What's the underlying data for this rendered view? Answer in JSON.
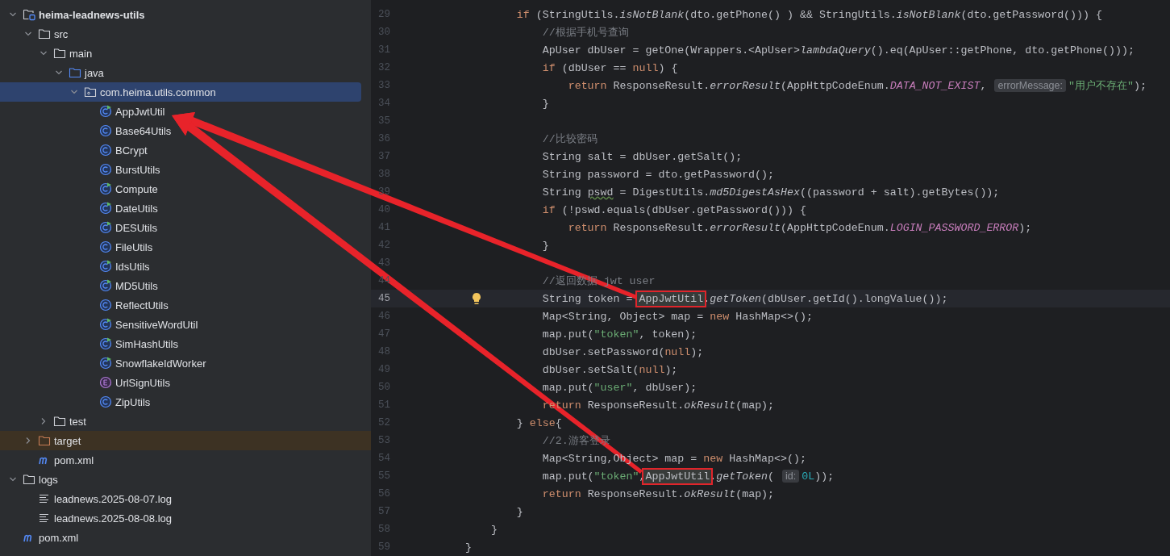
{
  "project_tree": {
    "items": [
      {
        "label": "heima-leadnews-utils",
        "kind": "module",
        "bold": true,
        "expanded": true,
        "selected": false,
        "children": [
          {
            "label": "src",
            "kind": "folder",
            "expanded": true,
            "selected": false,
            "children": [
              {
                "label": "main",
                "kind": "folder",
                "expanded": true,
                "selected": false,
                "children": [
                  {
                    "label": "java",
                    "kind": "source",
                    "expanded": true,
                    "selected": false,
                    "children": [
                      {
                        "label": "com.heima.utils.common",
                        "kind": "package",
                        "expanded": true,
                        "selected": true,
                        "children": [
                          {
                            "label": "AppJwtUtil",
                            "kind": "runnable",
                            "selected": false
                          },
                          {
                            "label": "Base64Utils",
                            "kind": "class",
                            "selected": false
                          },
                          {
                            "label": "BCrypt",
                            "kind": "class",
                            "selected": false
                          },
                          {
                            "label": "BurstUtils",
                            "kind": "class",
                            "selected": false
                          },
                          {
                            "label": "Compute",
                            "kind": "runnable",
                            "selected": false
                          },
                          {
                            "label": "DateUtils",
                            "kind": "runnable",
                            "selected": false
                          },
                          {
                            "label": "DESUtils",
                            "kind": "runnable",
                            "selected": false
                          },
                          {
                            "label": "FileUtils",
                            "kind": "class",
                            "selected": false
                          },
                          {
                            "label": "IdsUtils",
                            "kind": "runnable",
                            "selected": false
                          },
                          {
                            "label": "MD5Utils",
                            "kind": "runnable",
                            "selected": false
                          },
                          {
                            "label": "ReflectUtils",
                            "kind": "class",
                            "selected": false
                          },
                          {
                            "label": "SensitiveWordUtil",
                            "kind": "runnable",
                            "selected": false
                          },
                          {
                            "label": "SimHashUtils",
                            "kind": "runnable",
                            "selected": false
                          },
                          {
                            "label": "SnowflakeIdWorker",
                            "kind": "runnable",
                            "selected": false
                          },
                          {
                            "label": "UrlSignUtils",
                            "kind": "enum",
                            "selected": false
                          },
                          {
                            "label": "ZipUtils",
                            "kind": "class",
                            "selected": false
                          }
                        ]
                      }
                    ]
                  }
                ]
              },
              {
                "label": "test",
                "kind": "folder",
                "expanded": false,
                "selected": false
              }
            ]
          },
          {
            "label": "target",
            "kind": "excluded",
            "expanded": false,
            "selected": false
          },
          {
            "label": "pom.xml",
            "kind": "maven",
            "selected": false
          }
        ]
      },
      {
        "label": "logs",
        "kind": "folder",
        "expanded": true,
        "selected": false,
        "children": [
          {
            "label": "leadnews.2025-08-07.log",
            "kind": "log",
            "selected": false
          },
          {
            "label": "leadnews.2025-08-08.log",
            "kind": "log",
            "selected": false
          }
        ]
      },
      {
        "label": "pom.xml",
        "kind": "maven",
        "selected": false
      }
    ]
  },
  "editor": {
    "lines": [
      {
        "number": "29",
        "tokens": [
          {
            "kind": "keyword",
            "text": "        if"
          },
          {
            "kind": "plain",
            "text": " (StringUtils."
          },
          {
            "kind": "method",
            "text": "isNotBlank"
          },
          {
            "kind": "plain",
            "text": "(dto.getPhone() ) && StringUtils."
          },
          {
            "kind": "method",
            "text": "isNotBlank"
          },
          {
            "kind": "plain",
            "text": "(dto.getPassword())) {"
          }
        ]
      },
      {
        "number": "30",
        "tokens": [
          {
            "kind": "comment",
            "text": "            //根据手机号查询"
          }
        ]
      },
      {
        "number": "31",
        "tokens": [
          {
            "kind": "plain",
            "text": "            ApUser dbUser = getOne(Wrappers.<ApUser>"
          },
          {
            "kind": "method",
            "text": "lambdaQuery"
          },
          {
            "kind": "plain",
            "text": "().eq(ApUser::getPhone, dto.getPhone()));"
          }
        ]
      },
      {
        "number": "32",
        "tokens": [
          {
            "kind": "keyword",
            "text": "            if"
          },
          {
            "kind": "plain",
            "text": " (dbUser == "
          },
          {
            "kind": "keyword",
            "text": "null"
          },
          {
            "kind": "plain",
            "text": ") {"
          }
        ]
      },
      {
        "number": "33",
        "tokens": [
          {
            "kind": "keyword",
            "text": "                return"
          },
          {
            "kind": "plain",
            "text": " ResponseResult."
          },
          {
            "kind": "method",
            "text": "errorResult"
          },
          {
            "kind": "plain",
            "text": "(AppHttpCodeEnum."
          },
          {
            "kind": "constant",
            "text": "DATA_NOT_EXIST"
          },
          {
            "kind": "plain",
            "text": ", "
          },
          {
            "kind": "hint",
            "text": "errorMessage:"
          },
          {
            "kind": "string",
            "text": "\"用户不存在\""
          },
          {
            "kind": "plain",
            "text": ");"
          }
        ]
      },
      {
        "number": "34",
        "tokens": [
          {
            "kind": "plain",
            "text": "            }"
          }
        ]
      },
      {
        "number": "35"
      },
      {
        "number": "36",
        "tokens": [
          {
            "kind": "comment",
            "text": "            //比较密码"
          }
        ]
      },
      {
        "number": "37",
        "tokens": [
          {
            "kind": "plain",
            "text": "            String salt = dbUser.getSalt();"
          }
        ]
      },
      {
        "number": "38",
        "tokens": [
          {
            "kind": "plain",
            "text": "            String password = dto.getPassword();"
          }
        ]
      },
      {
        "number": "39",
        "tokens": [
          {
            "kind": "plain",
            "text": "            String "
          },
          {
            "kind": "warning",
            "text": "pswd"
          },
          {
            "kind": "plain",
            "text": " = DigestUtils."
          },
          {
            "kind": "method",
            "text": "md5DigestAsHex"
          },
          {
            "kind": "plain",
            "text": "((password + salt).getBytes());"
          }
        ]
      },
      {
        "number": "40",
        "tokens": [
          {
            "kind": "keyword",
            "text": "            if"
          },
          {
            "kind": "plain",
            "text": " (!pswd.equals(dbUser.getPassword())) {"
          }
        ]
      },
      {
        "number": "41",
        "tokens": [
          {
            "kind": "keyword",
            "text": "                return"
          },
          {
            "kind": "plain",
            "text": " ResponseResult."
          },
          {
            "kind": "method",
            "text": "errorResult"
          },
          {
            "kind": "plain",
            "text": "(AppHttpCodeEnum."
          },
          {
            "kind": "constant",
            "text": "LOGIN_PASSWORD_ERROR"
          },
          {
            "kind": "plain",
            "text": ");"
          }
        ]
      },
      {
        "number": "42",
        "tokens": [
          {
            "kind": "plain",
            "text": "            }"
          }
        ]
      },
      {
        "number": "43"
      },
      {
        "number": "44",
        "tokens": [
          {
            "kind": "comment",
            "text": "            //返回数据 jwt user"
          }
        ]
      },
      {
        "number": "45",
        "current": true,
        "tokens": [
          {
            "kind": "plain",
            "text": "            String token = "
          },
          {
            "kind": "reference",
            "text": "AppJwtUtil"
          },
          {
            "kind": "plain",
            "text": "."
          },
          {
            "kind": "method",
            "text": "getToken"
          },
          {
            "kind": "plain",
            "text": "(dbUser.getId().longValue());"
          }
        ]
      },
      {
        "number": "46",
        "tokens": [
          {
            "kind": "plain",
            "text": "            Map<String, Object> map = "
          },
          {
            "kind": "keyword",
            "text": "new"
          },
          {
            "kind": "plain",
            "text": " HashMap<>();"
          }
        ]
      },
      {
        "number": "47",
        "tokens": [
          {
            "kind": "plain",
            "text": "            map.put("
          },
          {
            "kind": "string",
            "text": "\"token\""
          },
          {
            "kind": "plain",
            "text": ", token);"
          }
        ]
      },
      {
        "number": "48",
        "tokens": [
          {
            "kind": "plain",
            "text": "            dbUser.setPassword("
          },
          {
            "kind": "keyword",
            "text": "null"
          },
          {
            "kind": "plain",
            "text": ");"
          }
        ]
      },
      {
        "number": "49",
        "tokens": [
          {
            "kind": "plain",
            "text": "            dbUser.setSalt("
          },
          {
            "kind": "keyword",
            "text": "null"
          },
          {
            "kind": "plain",
            "text": ");"
          }
        ]
      },
      {
        "number": "50",
        "tokens": [
          {
            "kind": "plain",
            "text": "            map.put("
          },
          {
            "kind": "string",
            "text": "\"user\""
          },
          {
            "kind": "plain",
            "text": ", dbUser);"
          }
        ]
      },
      {
        "number": "51",
        "tokens": [
          {
            "kind": "keyword",
            "text": "            return"
          },
          {
            "kind": "plain",
            "text": " ResponseResult."
          },
          {
            "kind": "method",
            "text": "okResult"
          },
          {
            "kind": "plain",
            "text": "(map);"
          }
        ]
      },
      {
        "number": "52",
        "tokens": [
          {
            "kind": "plain",
            "text": "        } "
          },
          {
            "kind": "keyword",
            "text": "else"
          },
          {
            "kind": "plain",
            "text": "{"
          }
        ]
      },
      {
        "number": "53",
        "tokens": [
          {
            "kind": "comment",
            "text": "            //2.游客登录"
          }
        ]
      },
      {
        "number": "54",
        "tokens": [
          {
            "kind": "plain",
            "text": "            Map<String,Object> map = "
          },
          {
            "kind": "keyword",
            "text": "new"
          },
          {
            "kind": "plain",
            "text": " HashMap<>();"
          }
        ]
      },
      {
        "number": "55",
        "tokens": [
          {
            "kind": "plain",
            "text": "            map.put("
          },
          {
            "kind": "string",
            "text": "\"token\""
          },
          {
            "kind": "plain",
            "text": ","
          },
          {
            "kind": "reference",
            "text": "AppJwtUtil"
          },
          {
            "kind": "plain",
            "text": "."
          },
          {
            "kind": "method",
            "text": "getToken"
          },
          {
            "kind": "plain",
            "text": "( "
          },
          {
            "kind": "hint",
            "text": "id:"
          },
          {
            "kind": "number",
            "text": "0L"
          },
          {
            "kind": "plain",
            "text": "));"
          }
        ]
      },
      {
        "number": "56",
        "tokens": [
          {
            "kind": "keyword",
            "text": "            return"
          },
          {
            "kind": "plain",
            "text": " ResponseResult."
          },
          {
            "kind": "method",
            "text": "okResult"
          },
          {
            "kind": "plain",
            "text": "(map);"
          }
        ]
      },
      {
        "number": "57",
        "tokens": [
          {
            "kind": "plain",
            "text": "        }"
          }
        ]
      },
      {
        "number": "58",
        "tokens": [
          {
            "kind": "plain",
            "text": "    }"
          }
        ]
      },
      {
        "number": "59",
        "tokens": [
          {
            "kind": "plain",
            "text": "}"
          }
        ]
      }
    ]
  }
}
